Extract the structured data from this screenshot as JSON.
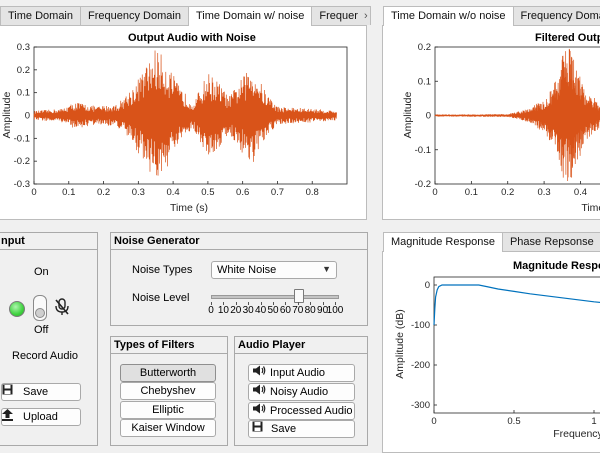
{
  "left_tabs": [
    "Time Domain",
    "Frequency Domain",
    "Time Domain w/ noise",
    "Frequer"
  ],
  "right_tabs": [
    "Time Domain w/o noise",
    "Frequency Domain"
  ],
  "bottom_right_tabs": [
    "Magnitude Response",
    "Phase Repsonse"
  ],
  "tab_scroll_icon": "chevron-right-icon",
  "chart_data": [
    {
      "type": "line",
      "title": "Output Audio with Noise",
      "xlabel": "Time (s)",
      "ylabel": "Amplitude",
      "xlim": [
        0,
        0.9
      ],
      "ylim": [
        -0.3,
        0.3
      ],
      "xticks": [
        "0",
        "0.1",
        "0.2",
        "0.3",
        "0.4",
        "0.5",
        "0.6",
        "0.7",
        "0.8"
      ],
      "yticks": [
        "0.3",
        "0.2",
        "0.1",
        "0",
        "-0.1",
        "-0.2",
        "-0.3"
      ],
      "color": "#d95319",
      "envelope": [
        {
          "t": 0.0,
          "a": 0.02
        },
        {
          "t": 0.08,
          "a": 0.03
        },
        {
          "t": 0.12,
          "a": 0.06
        },
        {
          "t": 0.18,
          "a": 0.04
        },
        {
          "t": 0.24,
          "a": 0.05
        },
        {
          "t": 0.28,
          "a": 0.12
        },
        {
          "t": 0.32,
          "a": 0.21
        },
        {
          "t": 0.35,
          "a": 0.3
        },
        {
          "t": 0.38,
          "a": 0.24
        },
        {
          "t": 0.42,
          "a": 0.12
        },
        {
          "t": 0.46,
          "a": 0.06
        },
        {
          "t": 0.5,
          "a": 0.19
        },
        {
          "t": 0.53,
          "a": 0.15
        },
        {
          "t": 0.56,
          "a": 0.08
        },
        {
          "t": 0.6,
          "a": 0.17
        },
        {
          "t": 0.63,
          "a": 0.22
        },
        {
          "t": 0.66,
          "a": 0.12
        },
        {
          "t": 0.7,
          "a": 0.04
        },
        {
          "t": 0.8,
          "a": 0.03
        },
        {
          "t": 0.88,
          "a": 0.02
        }
      ]
    },
    {
      "type": "line",
      "title": "Filtered Outp",
      "xlabel": "Time (",
      "ylabel": "Amplitude",
      "xlim": [
        0,
        0.55
      ],
      "ylim": [
        -0.2,
        0.2
      ],
      "xticks": [
        "0",
        "0.1",
        "0.2",
        "0.3",
        "0.4"
      ],
      "yticks": [
        "0.2",
        "0.1",
        "0",
        "-0.1",
        "-0.2"
      ],
      "color": "#d95319",
      "envelope": [
        {
          "t": 0.0,
          "a": 0.003
        },
        {
          "t": 0.2,
          "a": 0.004
        },
        {
          "t": 0.26,
          "a": 0.02
        },
        {
          "t": 0.3,
          "a": 0.05
        },
        {
          "t": 0.33,
          "a": 0.1
        },
        {
          "t": 0.35,
          "a": 0.18
        },
        {
          "t": 0.37,
          "a": 0.2
        },
        {
          "t": 0.39,
          "a": 0.14
        },
        {
          "t": 0.42,
          "a": 0.07
        },
        {
          "t": 0.46,
          "a": 0.03
        },
        {
          "t": 0.55,
          "a": 0.08
        }
      ]
    },
    {
      "type": "line",
      "title": "Magnitude Respo",
      "xlabel": "Frequency",
      "ylabel": "Amplitude (dB)",
      "xlim": [
        0,
        1.25
      ],
      "ylim": [
        -320,
        20
      ],
      "xticks": [
        "0",
        "0.5",
        "1"
      ],
      "yticks": [
        "0",
        "-100",
        "-200",
        "-300"
      ],
      "color": "#0072bd",
      "x": [
        0,
        0.005,
        0.01,
        0.02,
        0.03,
        0.05,
        0.1,
        0.2,
        0.28,
        0.33,
        0.4,
        0.5,
        0.6,
        0.7,
        0.8,
        0.9,
        1.0,
        1.1,
        1.2,
        1.25
      ],
      "y": [
        -100,
        -60,
        -30,
        -12,
        -4,
        0,
        0,
        0,
        0,
        -4,
        -10,
        -16,
        -22,
        -27,
        -32,
        -37,
        -42,
        -46,
        -50,
        -53
      ]
    }
  ],
  "input_panel": {
    "title": "nput",
    "state_on": "On",
    "state_off": "Off",
    "record_label": "Record Audio",
    "save_label": "Save",
    "upload_label": "Upload",
    "lamp_color": "#3fd23f",
    "mic_icon": "microphone-muted-icon"
  },
  "noise_panel": {
    "title": "Noise Generator",
    "type_label": "Noise Types",
    "type_value": "White Noise",
    "level_label": "Noise Level",
    "level_value": 70,
    "slider_ticks": [
      "0",
      "10",
      "20",
      "30",
      "40",
      "50",
      "60",
      "70",
      "80",
      "90",
      "100"
    ]
  },
  "filters_panel": {
    "title": "Types of Filters",
    "items": [
      "Butterworth",
      "Chebyshev",
      "Elliptic",
      "Kaiser Window"
    ],
    "selected": "Butterworth"
  },
  "player_panel": {
    "title": "Audio Player",
    "input_label": "Input Audio",
    "noisy_label": "Noisy Audio",
    "processed_label": "Processed Audio",
    "save_label": "Save"
  }
}
